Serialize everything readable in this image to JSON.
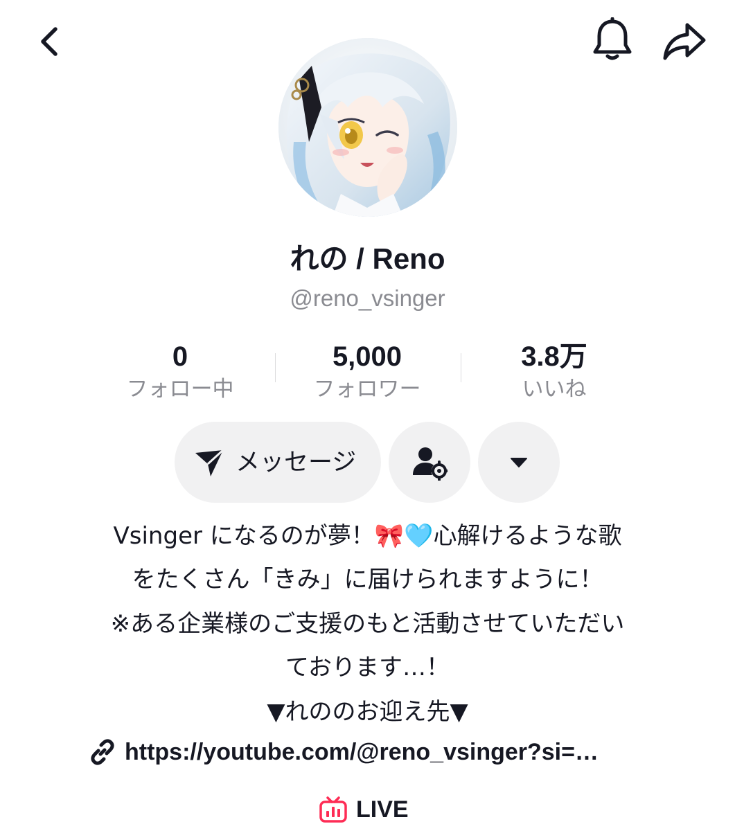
{
  "colors": {
    "text_primary": "#161823",
    "text_secondary": "#8a8b91",
    "button_bg": "#f1f1f2",
    "live_accent": "#fe2c55"
  },
  "icons": {
    "back": "chevron-left-icon",
    "bell": "bell-icon",
    "share": "share-arrow-icon",
    "message": "send-icon",
    "friend": "user-gear-icon",
    "more": "caret-down-icon",
    "link": "link-icon",
    "live": "live-tv-icon"
  },
  "profile": {
    "display_name": "れの / Reno",
    "handle": "@reno_vsinger"
  },
  "stats": {
    "following": {
      "value": "0",
      "label": "フォロー中"
    },
    "followers": {
      "value": "5,000",
      "label": "フォロワー"
    },
    "likes": {
      "value": "3.8万",
      "label": "いいね"
    }
  },
  "actions": {
    "message_label": "メッセージ"
  },
  "bio": {
    "line1_text": "Vsinger になるのが夢！",
    "line1_emoji_bow": "🎀",
    "line1_emoji_heart": "🩵",
    "line1_tail": "心解けるような歌",
    "line2": "をたくさん「きみ」に届けられますように！",
    "line3": "※ある企業様のご支援のもと活動させていただい",
    "line4": "ております…！",
    "line5": "▼れののお迎え先▼"
  },
  "link": {
    "text": "https://youtube.com/@reno_vsinger?si=…"
  },
  "live": {
    "label": "LIVE"
  }
}
